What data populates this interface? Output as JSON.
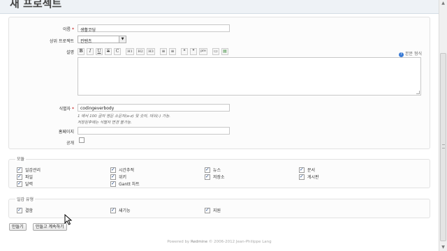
{
  "page": {
    "title": "새 프로젝트"
  },
  "form": {
    "name_label": "이름",
    "name_value": "생활코딩",
    "parent_label": "상위 프로젝트",
    "parent_value": "컨텐츠",
    "description_label": "설명",
    "text_format_label": "본문 형식",
    "identifier_label": "식별자",
    "identifier_value": "codingeverbody",
    "identifier_hint_1": "1 에서 100 글자 영문 소문자(a-z) 및 숫자, 대쉬(-) 가능.",
    "identifier_hint_2": "저장된후에는 식별자 변경 불가능.",
    "homepage_label": "홈페이지",
    "homepage_value": "",
    "public_label": "공개",
    "required_mark": "*"
  },
  "toolbar": {
    "buttons": [
      {
        "name": "bold-button",
        "label": "B"
      },
      {
        "name": "italic-button",
        "label": "I"
      },
      {
        "name": "underline-button",
        "label": "U"
      },
      {
        "name": "strike-button",
        "label": "S"
      },
      {
        "name": "code-button",
        "label": "C"
      },
      {
        "name": "heading1-button",
        "label": "H1"
      },
      {
        "name": "heading2-button",
        "label": "H2"
      },
      {
        "name": "heading3-button",
        "label": "H3"
      },
      {
        "name": "unordered-list-button",
        "label": "≡"
      },
      {
        "name": "ordered-list-button",
        "label": "≡"
      },
      {
        "name": "quote-button",
        "label": "❝"
      },
      {
        "name": "unquote-button",
        "label": "❞"
      },
      {
        "name": "pre-button",
        "label": "pre"
      },
      {
        "name": "wiki-link-button",
        "label": "▭"
      },
      {
        "name": "image-button",
        "label": "▤"
      }
    ]
  },
  "modules": {
    "legend": "모듈",
    "items": [
      {
        "label": "일감관리",
        "checked": true
      },
      {
        "label": "시간추적",
        "checked": true
      },
      {
        "label": "뉴스",
        "checked": true
      },
      {
        "label": "문서",
        "checked": true
      },
      {
        "label": "파일",
        "checked": true
      },
      {
        "label": "위키",
        "checked": true
      },
      {
        "label": "저장소",
        "checked": true
      },
      {
        "label": "게시판",
        "checked": true
      },
      {
        "label": "달력",
        "checked": true
      },
      {
        "label": "Gantt 차트",
        "checked": true
      }
    ]
  },
  "trackers": {
    "legend": "일감 유형",
    "items": [
      {
        "label": "결함",
        "checked": true
      },
      {
        "label": "새기능",
        "checked": true
      },
      {
        "label": "지원",
        "checked": true
      }
    ]
  },
  "actions": {
    "create_label": "만들기",
    "create_continue_label": "만들고 계속하기"
  },
  "footer": {
    "powered_by": "Powered by",
    "redmine_link": "Redmine",
    "copyright": "© 2006-2012 Jean-Philippe Lang"
  }
}
